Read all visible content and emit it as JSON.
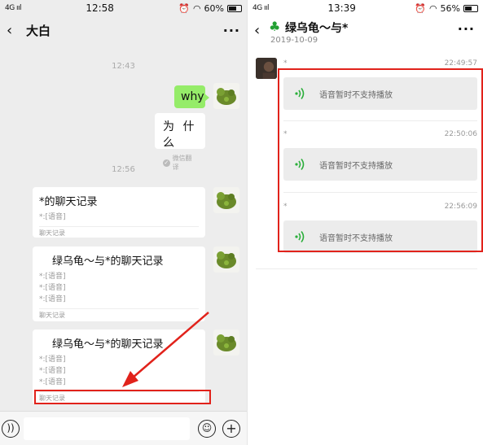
{
  "left": {
    "status": {
      "signal": "4G ııl",
      "time": "12:58",
      "icons": "⏰",
      "battery": "60%"
    },
    "nav": {
      "back": "‹",
      "title": "大白",
      "more": "···"
    },
    "times": [
      "12:43",
      "12:56"
    ],
    "msg_why": "why",
    "translate": {
      "text": "为 什 么",
      "hint": "微信翻译"
    },
    "records": [
      {
        "title": "*的聊天记录",
        "lines": [
          "*:[语音]"
        ],
        "footer": "聊天记录"
      },
      {
        "title": "绿乌龟～与*的聊天记录",
        "lines": [
          "*:[语音]",
          "*:[语音]",
          "*:[语音]"
        ],
        "footer": "聊天记录"
      },
      {
        "title": "绿乌龟～与*的聊天记录",
        "lines": [
          "*:[语音]",
          "*:[语音]",
          "*:[语音]"
        ],
        "footer": "聊天记录"
      }
    ],
    "input": {
      "voice_glyph": "))",
      "emoji_glyph": "☺",
      "plus_glyph": "+"
    },
    "colors": {
      "bg": "#ededed",
      "bubble": "#95ec69",
      "annotation": "#e1221b"
    }
  },
  "right": {
    "status": {
      "signal": "4G ııl",
      "time": "13:39",
      "icons": "⏰",
      "battery": "56%"
    },
    "nav": {
      "back": "‹",
      "emoji": "♣",
      "title": "绿乌龟～与*",
      "date": "2019-10-09",
      "more": "···"
    },
    "messages": [
      {
        "sender": "*",
        "time": "22:49:57",
        "text": "语音暂时不支持播放"
      },
      {
        "sender": "*",
        "time": "22:50:06",
        "text": "语音暂时不支持播放"
      },
      {
        "sender": "*",
        "time": "22:56:09",
        "text": "语音暂时不支持播放"
      }
    ]
  }
}
